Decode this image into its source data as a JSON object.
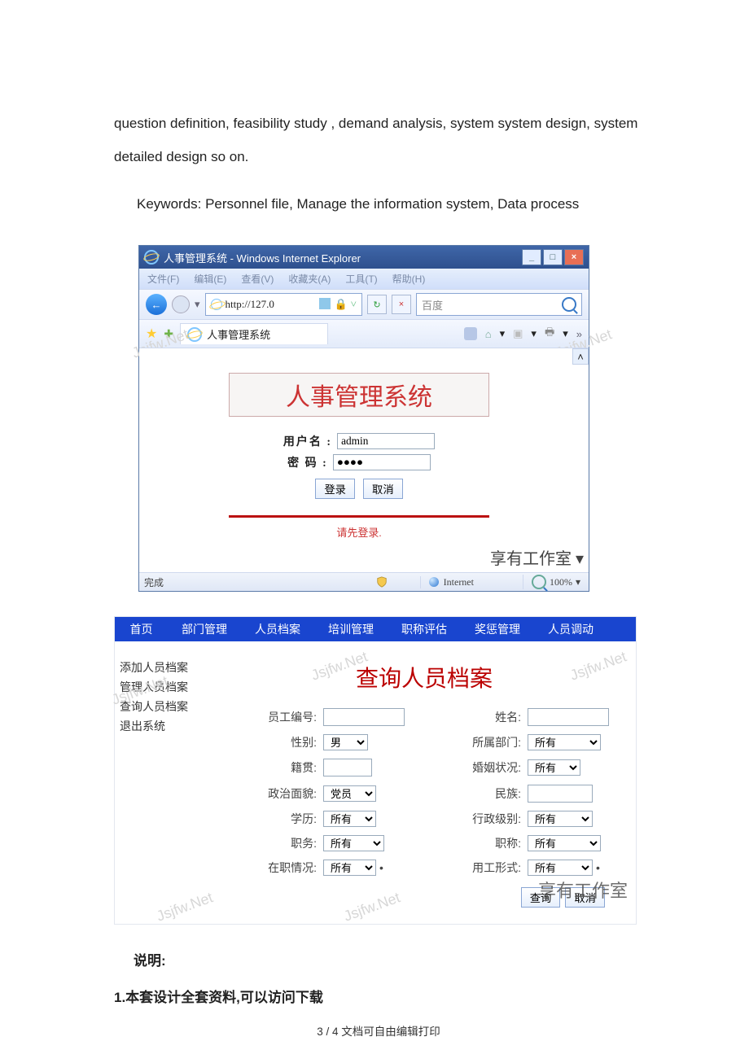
{
  "paragraph1": "question definition, feasibility study , demand analysis, system system design, system detailed design so on.",
  "paragraph2": "Keywords: Personnel file, Manage the information system, Data process",
  "ie": {
    "title": "人事管理系统 - Windows Internet Explorer",
    "menu": [
      "文件(F)",
      "编辑(E)",
      "查看(V)",
      "收藏夹(A)",
      "工具(T)",
      "帮助(H)"
    ],
    "address": "http://127.0",
    "search_placeholder": "百度",
    "tab_title": "人事管理系统",
    "login_title": "人事管理系统",
    "username_label": "用户名 :",
    "password_label": "密 码 :",
    "username_value": "admin",
    "password_value": "●●●●",
    "btn_login": "登录",
    "btn_cancel": "取消",
    "login_msg": "请先登录.",
    "brand": "享有工作室",
    "status_done": "完成",
    "status_zone": "Internet",
    "status_zoom": "100%"
  },
  "app": {
    "nav": [
      "首页",
      "部门管理",
      "人员档案",
      "培训管理",
      "职称评估",
      "奖惩管理",
      "人员调动"
    ],
    "side": [
      "添加人员档案",
      "管理人员档案",
      "查询人员档案",
      "退出系统"
    ],
    "title": "查询人员档案",
    "fields": {
      "emp_no": "员工编号:",
      "name": "姓名:",
      "gender": "性别:",
      "gender_val": "男",
      "dept": "所属部门:",
      "dept_val": "所有",
      "native": "籍贯:",
      "marriage": "婚姻状况:",
      "marriage_val": "所有",
      "political": "政治面貌:",
      "political_val": "党员",
      "nation": "民族:",
      "edu": "学历:",
      "edu_val": "所有",
      "admin_level": "行政级别:",
      "admin_level_val": "所有",
      "post": "职务:",
      "post_val": "所有",
      "title_f": "职称:",
      "title_val": "所有",
      "job_status": "在职情况:",
      "job_status_val": "所有",
      "emp_type": "用工形式:",
      "emp_type_val": "所有"
    },
    "btn_query": "查询",
    "btn_cancel": "取消",
    "brand": "享有工作室"
  },
  "note_heading": "说明:",
  "note_item1": "1.本套设计全套资料,可以访问下载",
  "footer": "3 / 4 文档可自由编辑打印",
  "watermark": "Jsjfw.Net"
}
